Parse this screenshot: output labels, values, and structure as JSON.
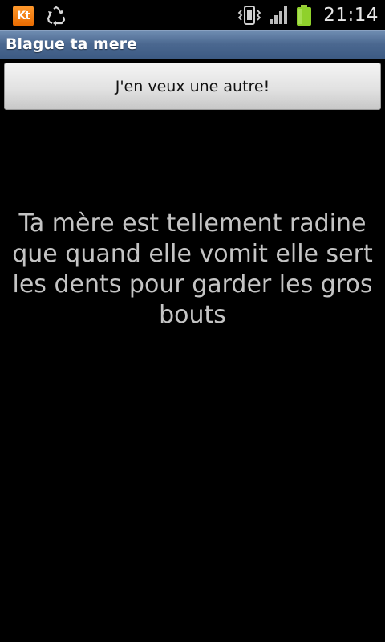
{
  "status_bar": {
    "left_icons": [
      "kt-app-icon",
      "recycle-icon"
    ],
    "kt_label": "Kt",
    "right_icons": [
      "vibrate-icon",
      "signal-icon",
      "battery-icon"
    ],
    "time": "21:14",
    "battery_color": "#8fd12b"
  },
  "app": {
    "title": "Blague ta mere",
    "title_bar_color": "#4b6890"
  },
  "main": {
    "button_label": "J'en veux une autre!",
    "joke": "Ta mère est tellement radine que quand elle vomit elle sert les dents pour garder les gros bouts"
  }
}
